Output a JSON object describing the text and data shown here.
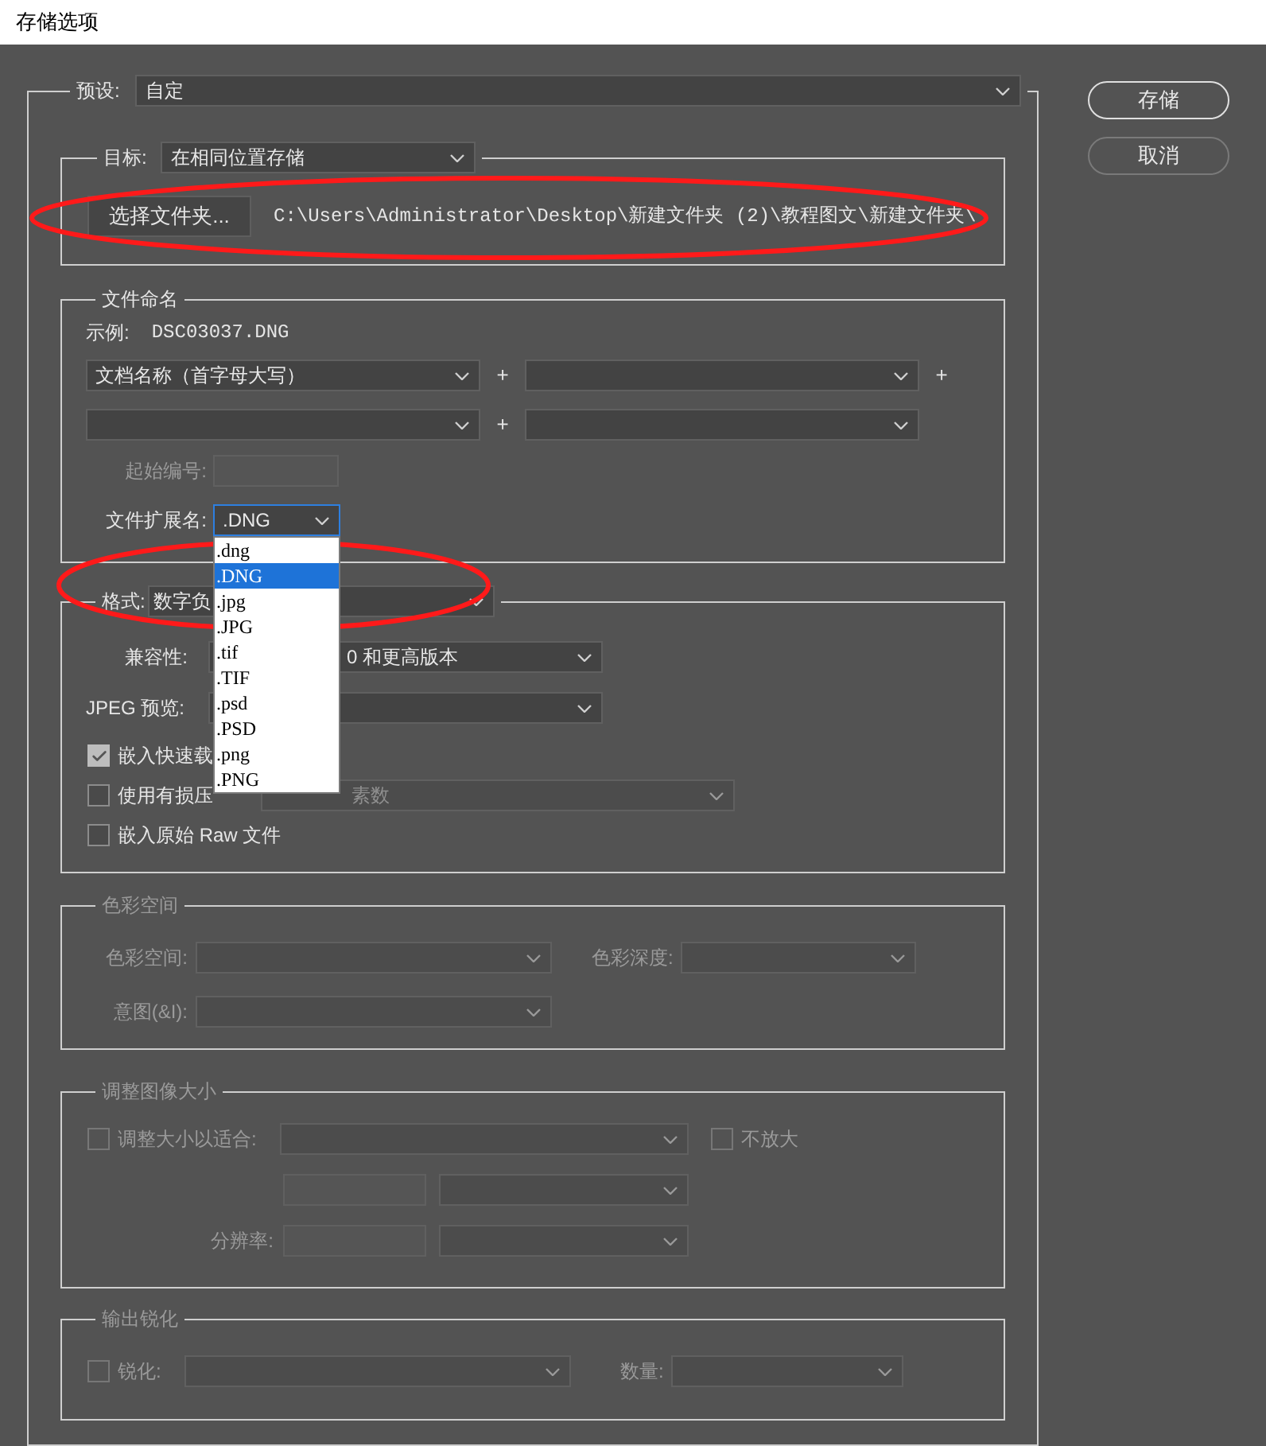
{
  "window": {
    "title": "存储选项"
  },
  "buttons": [
    {
      "label": "存储",
      "default": true
    },
    {
      "label": "取消",
      "default": false
    }
  ],
  "preset": {
    "label": "预设:",
    "value": "自定"
  },
  "destination": {
    "label": "目标:",
    "value": "在相同位置存储",
    "folder_button": "选择文件夹...",
    "path": "C:\\Users\\Administrator\\Desktop\\新建文件夹 (2)\\教程图文\\新建文件夹\\"
  },
  "file_naming": {
    "title": "文件命名",
    "example_label": "示例:",
    "example": "DSC03037.DNG",
    "name_parts": [
      {
        "kind": "select",
        "value": "文档名称（首字母大写）",
        "joiner": "+"
      },
      {
        "kind": "select",
        "joiner": "+"
      },
      {
        "kind": "select",
        "joiner": "+"
      },
      {
        "kind": "select"
      }
    ],
    "start_number": {
      "label": "起始编号:",
      "disabled": true
    },
    "extension": {
      "label": "文件扩展名:",
      "value": ".DNG",
      "expanded": true,
      "options": [
        {
          "label": ".dng",
          "selected": false
        },
        {
          "label": ".DNG",
          "selected": true
        },
        {
          "label": ".jpg",
          "selected": false
        },
        {
          "label": ".JPG",
          "selected": false
        },
        {
          "label": ".tif",
          "selected": false
        },
        {
          "label": ".TIF",
          "selected": false
        },
        {
          "label": ".psd",
          "selected": false
        },
        {
          "label": ".PSD",
          "selected": false
        },
        {
          "label": ".png",
          "selected": false
        },
        {
          "label": ".PNG",
          "selected": false
        }
      ]
    }
  },
  "format": {
    "label": "格式:",
    "value": "数字负",
    "compatibility_label": "兼容性:",
    "compatibility_value": "0 和更高版本",
    "jpeg_preview_label": "JPEG 预览:",
    "options": [
      {
        "kind": "checkbox",
        "label": "嵌入快速载",
        "checked": true
      },
      {
        "kind": "checkbox_select",
        "label": "使用有损压",
        "checked": false,
        "value": "素数",
        "disabled": true
      },
      {
        "kind": "checkbox",
        "label": "嵌入原始 Raw 文件",
        "checked": false
      }
    ]
  },
  "color_space": {
    "title": "色彩空间",
    "disabled": true,
    "space_label": "色彩空间:",
    "depth_label": "色彩深度:",
    "intent_label": "意图(&I):"
  },
  "image_size": {
    "title": "调整图像大小",
    "disabled": true,
    "fit_label": "调整大小以适合:",
    "fit_checked": false,
    "no_enlarge_label": "不放大",
    "no_enlarge_checked": false,
    "resolution_label": "分辨率:"
  },
  "sharpening": {
    "title": "输出锐化",
    "disabled": true,
    "sharpen_label": "锐化:",
    "sharpen_checked": false,
    "amount_label": "数量:"
  }
}
